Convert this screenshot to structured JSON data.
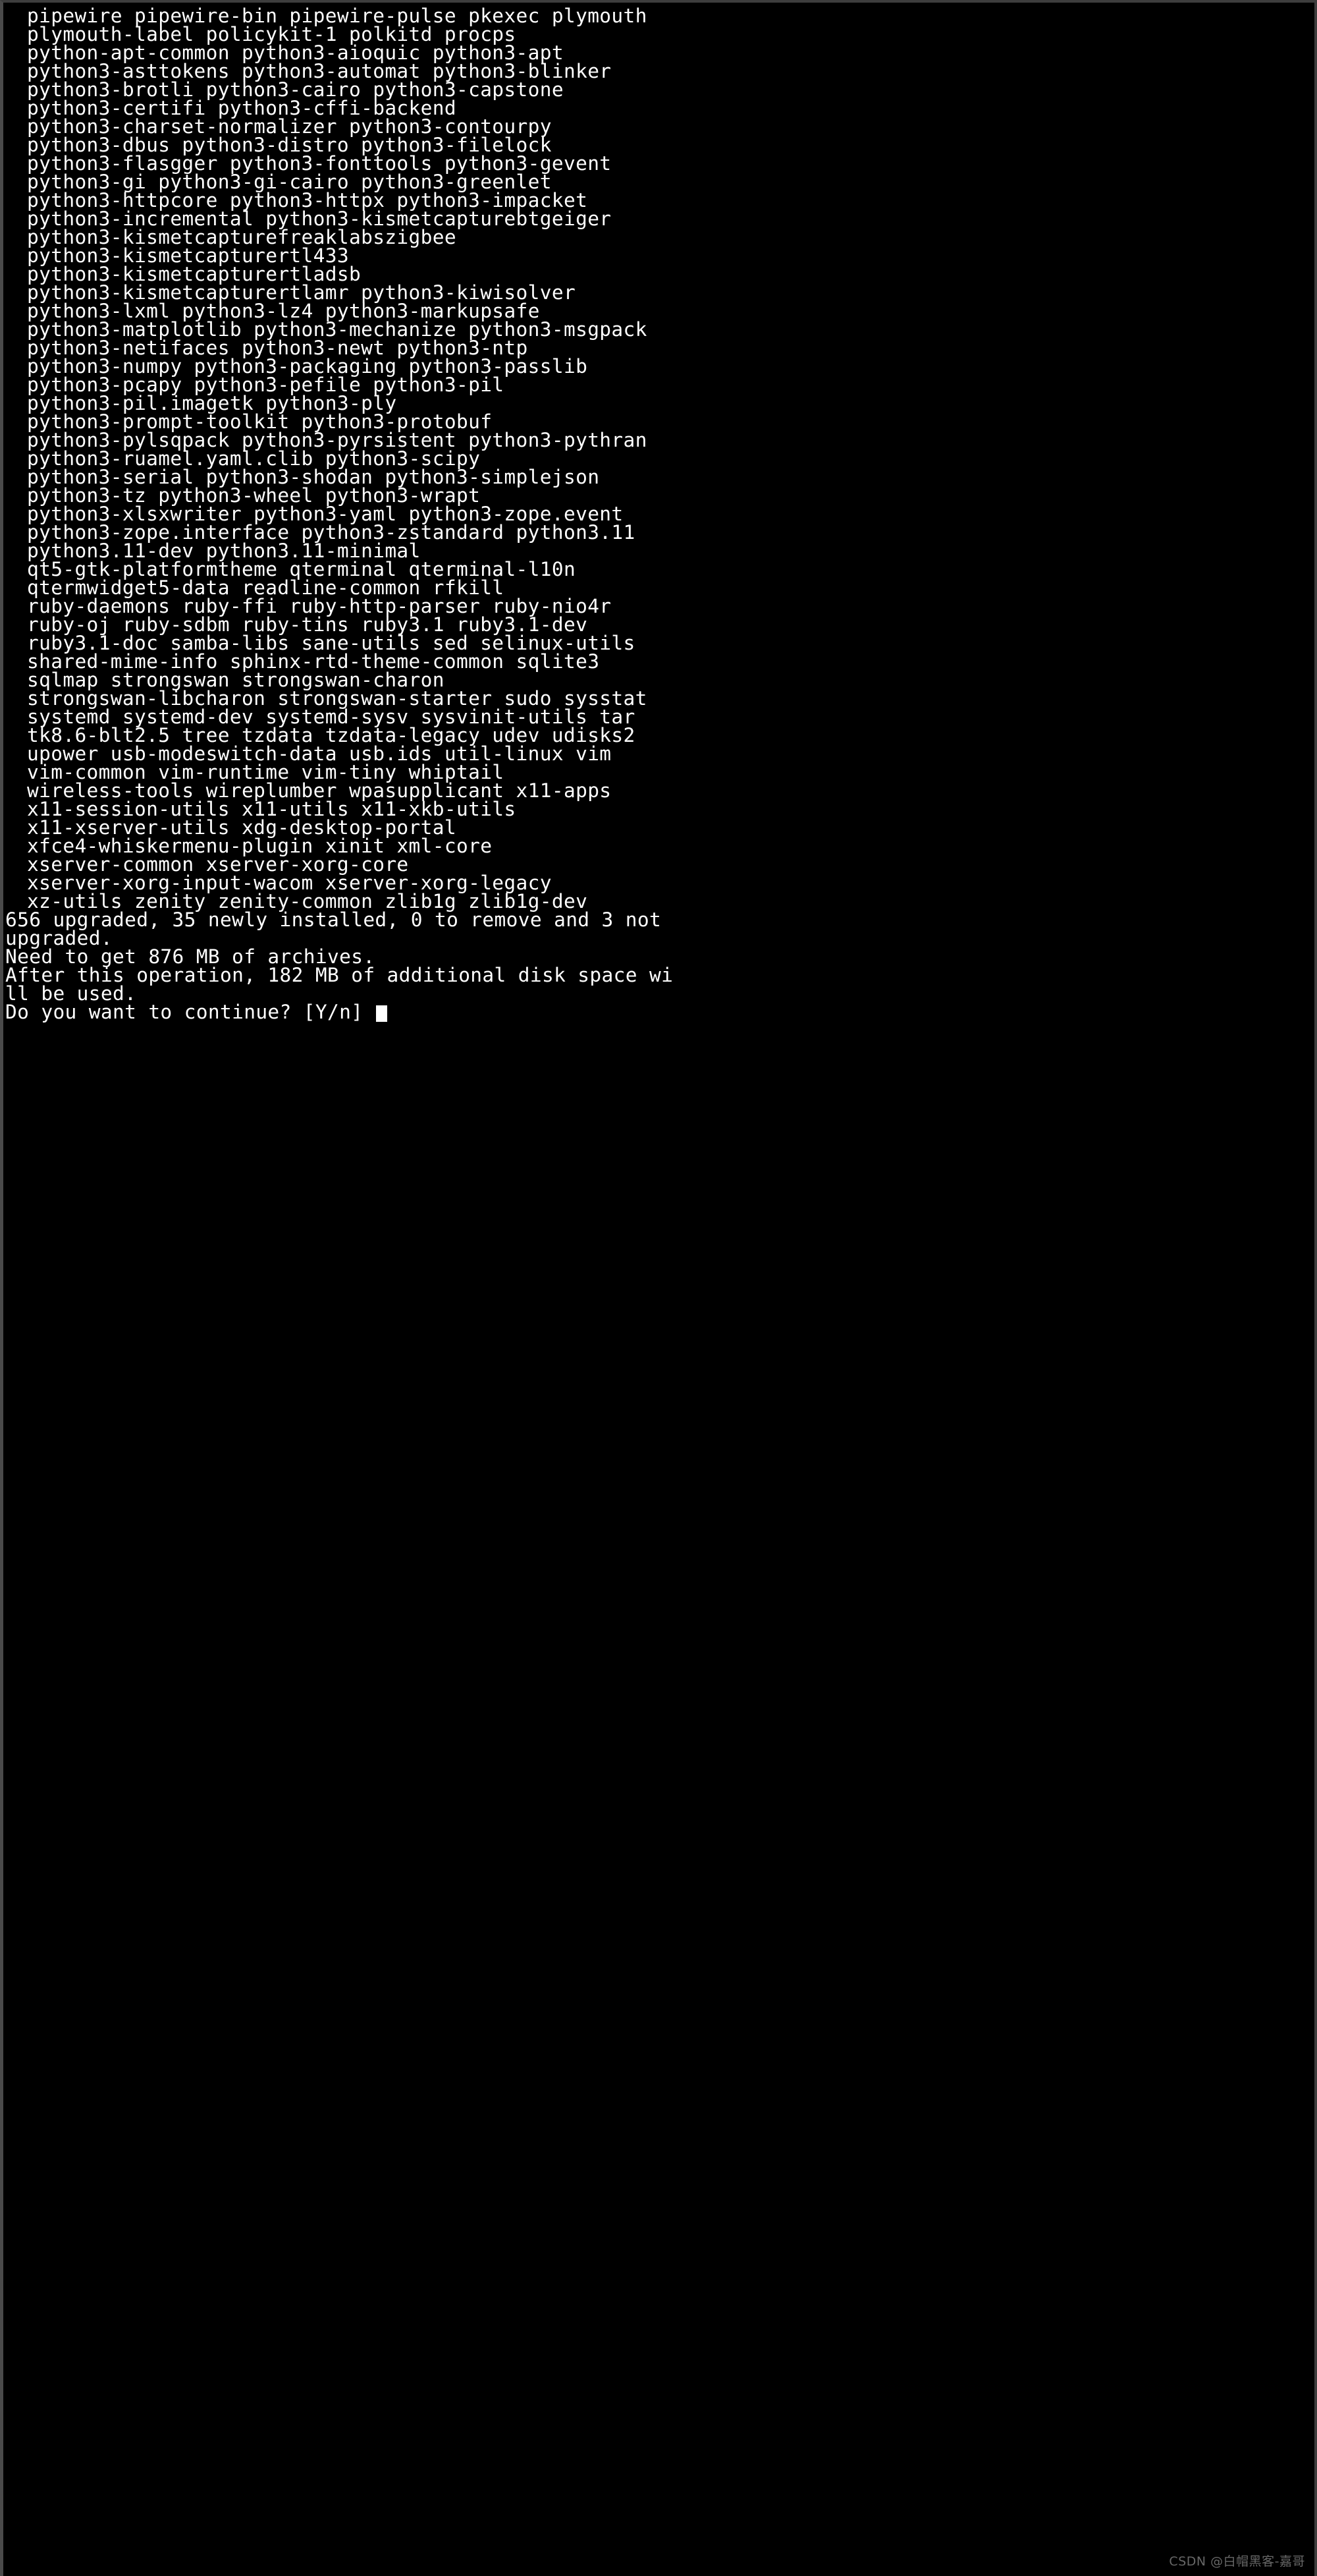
{
  "window": {
    "title": "Terminal",
    "background_color": "#000000",
    "foreground_color": "#ffffff",
    "border_color": "#3d3d3d",
    "cursor_color": "#ffffff"
  },
  "terminal": {
    "package_lines": [
      "pipewire pipewire-bin pipewire-pulse pkexec plymouth",
      "plymouth-label policykit-1 polkitd procps",
      "python-apt-common python3-aioquic python3-apt",
      "python3-asttokens python3-automat python3-blinker",
      "python3-brotli python3-cairo python3-capstone",
      "python3-certifi python3-cffi-backend",
      "python3-charset-normalizer python3-contourpy",
      "python3-dbus python3-distro python3-filelock",
      "python3-flasgger python3-fonttools python3-gevent",
      "python3-gi python3-gi-cairo python3-greenlet",
      "python3-httpcore python3-httpx python3-impacket",
      "python3-incremental python3-kismetcapturebtgeiger",
      "python3-kismetcapturefreaklabszigbee",
      "python3-kismetcapturertl433",
      "python3-kismetcapturertladsb",
      "python3-kismetcapturertlamr python3-kiwisolver",
      "python3-lxml python3-lz4 python3-markupsafe",
      "python3-matplotlib python3-mechanize python3-msgpack",
      "python3-netifaces python3-newt python3-ntp",
      "python3-numpy python3-packaging python3-passlib",
      "python3-pcapy python3-pefile python3-pil",
      "python3-pil.imagetk python3-ply",
      "python3-prompt-toolkit python3-protobuf",
      "python3-pylsqpack python3-pyrsistent python3-pythran",
      "python3-ruamel.yaml.clib python3-scipy",
      "python3-serial python3-shodan python3-simplejson",
      "python3-tz python3-wheel python3-wrapt",
      "python3-xlsxwriter python3-yaml python3-zope.event",
      "python3-zope.interface python3-zstandard python3.11",
      "python3.11-dev python3.11-minimal",
      "qt5-gtk-platformtheme qterminal qterminal-l10n",
      "qtermwidget5-data readline-common rfkill",
      "ruby-daemons ruby-ffi ruby-http-parser ruby-nio4r",
      "ruby-oj ruby-sdbm ruby-tins ruby3.1 ruby3.1-dev",
      "ruby3.1-doc samba-libs sane-utils sed selinux-utils",
      "shared-mime-info sphinx-rtd-theme-common sqlite3",
      "sqlmap strongswan strongswan-charon",
      "strongswan-libcharon strongswan-starter sudo sysstat",
      "systemd systemd-dev systemd-sysv sysvinit-utils tar",
      "tk8.6-blt2.5 tree tzdata tzdata-legacy udev udisks2",
      "upower usb-modeswitch-data usb.ids util-linux vim",
      "vim-common vim-runtime vim-tiny whiptail",
      "wireless-tools wireplumber wpasupplicant x11-apps",
      "x11-session-utils x11-utils x11-xkb-utils",
      "x11-xserver-utils xdg-desktop-portal",
      "xfce4-whiskermenu-plugin xinit xml-core",
      "xserver-common xserver-xorg-core",
      "xserver-xorg-input-wacom xserver-xorg-legacy",
      "xz-utils zenity zenity-common zlib1g zlib1g-dev"
    ],
    "summary_lines": [
      "656 upgraded, 35 newly installed, 0 to remove and 3 not",
      "upgraded.",
      "Need to get 876 MB of archives.",
      "After this operation, 182 MB of additional disk space wi",
      "ll be used."
    ],
    "summary_values": {
      "upgraded_count": 656,
      "newly_installed_count": 35,
      "to_remove_count": 0,
      "not_upgraded_count": 3,
      "archives_size": "876 MB",
      "additional_disk_space": "182 MB"
    },
    "prompt": {
      "text": "Do you want to continue? [Y/n] ",
      "options": [
        "Y",
        "n"
      ],
      "default_option": "Y",
      "cursor": "block-cursor"
    }
  },
  "watermark": {
    "text": "CSDN @白帽黑客-嘉哥"
  }
}
